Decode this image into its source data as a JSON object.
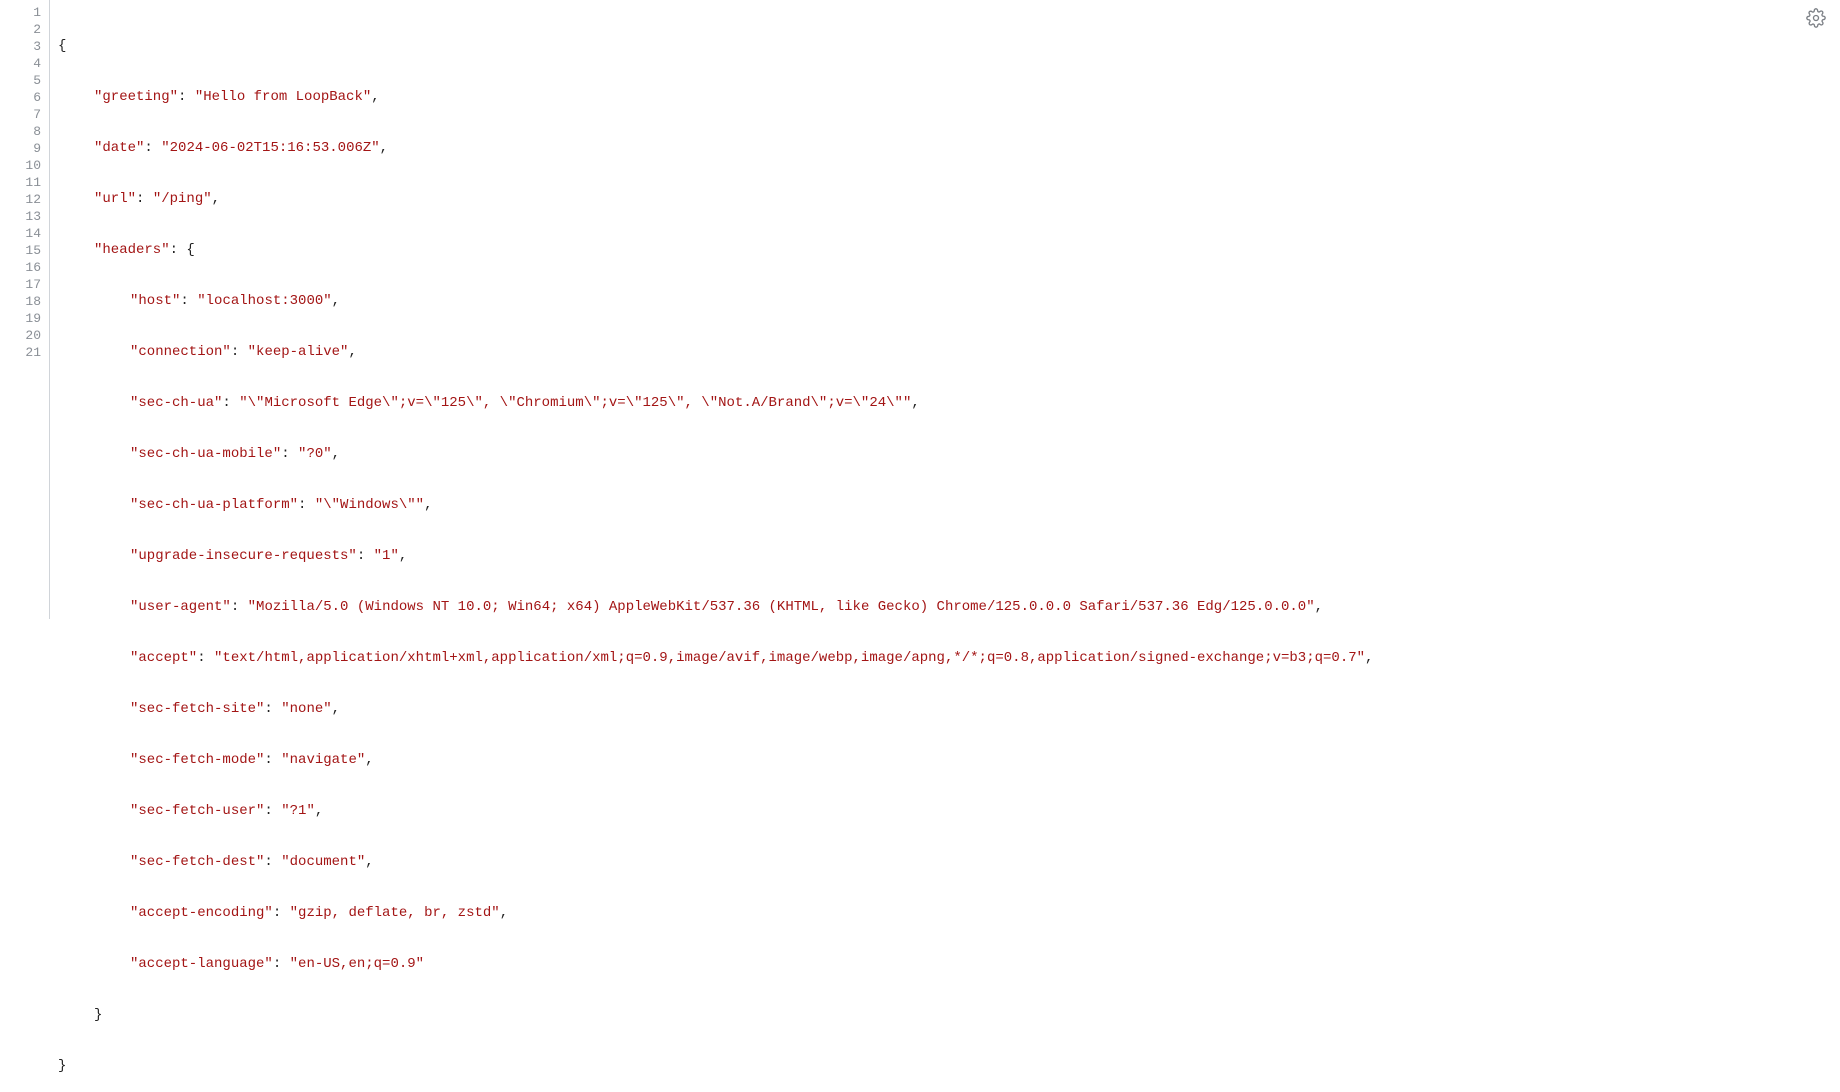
{
  "lines": [
    "1",
    "2",
    "3",
    "4",
    "5",
    "6",
    "7",
    "8",
    "9",
    "10",
    "11",
    "12",
    "13",
    "14",
    "15",
    "16",
    "17",
    "18",
    "19",
    "20",
    "21"
  ],
  "code": {
    "greeting_key": "\"greeting\"",
    "greeting_val": "\"Hello from LoopBack\"",
    "date_key": "\"date\"",
    "date_val": "\"2024-06-02T15:16:53.006Z\"",
    "url_key": "\"url\"",
    "url_val": "\"/ping\"",
    "headers_key": "\"headers\"",
    "host_key": "\"host\"",
    "host_val": "\"localhost:3000\"",
    "connection_key": "\"connection\"",
    "connection_val": "\"keep-alive\"",
    "sec_ch_ua_key": "\"sec-ch-ua\"",
    "sec_ch_ua_val": "\"\\\"Microsoft Edge\\\";v=\\\"125\\\", \\\"Chromium\\\";v=\\\"125\\\", \\\"Not.A/Brand\\\";v=\\\"24\\\"\"",
    "sec_ch_ua_mobile_key": "\"sec-ch-ua-mobile\"",
    "sec_ch_ua_mobile_val": "\"?0\"",
    "sec_ch_ua_platform_key": "\"sec-ch-ua-platform\"",
    "sec_ch_ua_platform_val": "\"\\\"Windows\\\"\"",
    "upgrade_key": "\"upgrade-insecure-requests\"",
    "upgrade_val": "\"1\"",
    "ua_key": "\"user-agent\"",
    "ua_val": "\"Mozilla/5.0 (Windows NT 10.0; Win64; x64) AppleWebKit/537.36 (KHTML, like Gecko) Chrome/125.0.0.0 Safari/537.36 Edg/125.0.0.0\"",
    "accept_key": "\"accept\"",
    "accept_val": "\"text/html,application/xhtml+xml,application/xml;q=0.9,image/avif,image/webp,image/apng,*/*;q=0.8,application/signed-exchange;v=b3;q=0.7\"",
    "sfs_key": "\"sec-fetch-site\"",
    "sfs_val": "\"none\"",
    "sfm_key": "\"sec-fetch-mode\"",
    "sfm_val": "\"navigate\"",
    "sfu_key": "\"sec-fetch-user\"",
    "sfu_val": "\"?1\"",
    "sfd_key": "\"sec-fetch-dest\"",
    "sfd_val": "\"document\"",
    "ae_key": "\"accept-encoding\"",
    "ae_val": "\"gzip, deflate, br, zstd\"",
    "al_key": "\"accept-language\"",
    "al_val": "\"en-US,en;q=0.9\"",
    "brace_open": "{",
    "brace_close": "}",
    "colon_brace": ": {",
    "colon_sp": ": ",
    "comma": ","
  },
  "icons": {
    "gear": "gear-icon"
  }
}
